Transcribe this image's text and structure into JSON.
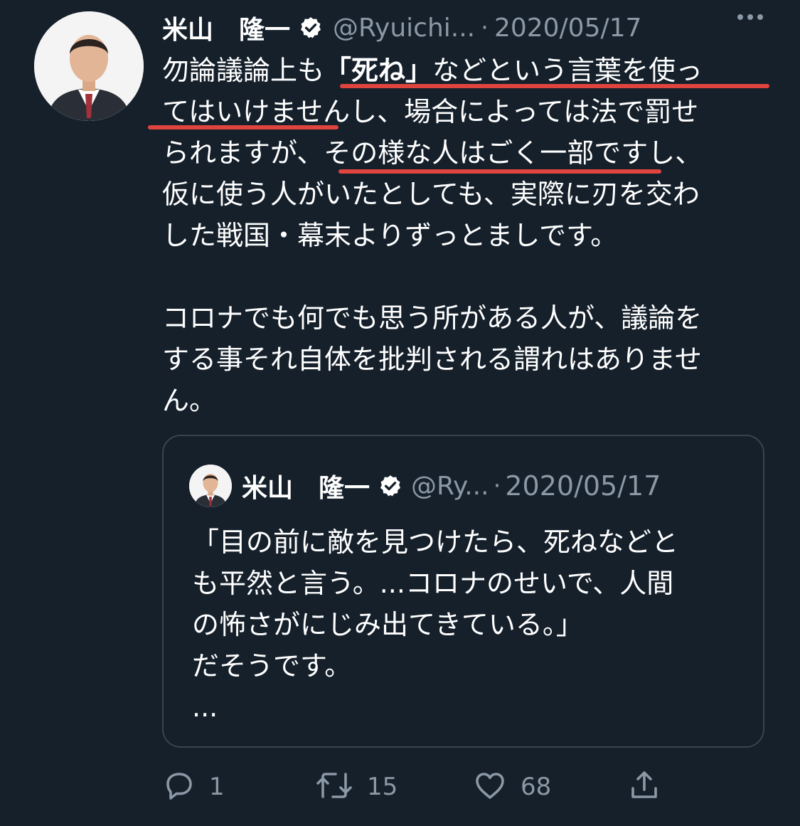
{
  "tweet": {
    "author_name": "米山　隆一",
    "handle": "@Ryuichi...",
    "separator": "·",
    "date": "2020/05/17",
    "body": {
      "line1_pre": "勿論議論上も",
      "line1_bold": "「死ね」",
      "line1_post": "などという言葉を使っ",
      "line2": "てはいけませんし、場合によっては法で罰せ",
      "line3": "られますが、その様な人はごく一部ですし、",
      "line4": "仮に使う人がいたとしても、実際に刃を交わ",
      "line5": "した戦国・幕末よりずっとましです。",
      "line6": "コロナでも何でも思う所がある人が、議論を",
      "line7": "する事それ自体を批判される謂れはありませ",
      "line8": "ん。"
    },
    "highlight_color": "#e0443e"
  },
  "quoted_tweet": {
    "author_name": "米山　隆一",
    "handle": "@Ry...",
    "separator": "·",
    "date": "2020/05/17",
    "lines": [
      "「目の前に敵を見つけたら、死ねなどと",
      "も平然と言う。...コロナのせいで、人間",
      "の怖さがにじみ出てきている。」",
      "だそうです。",
      "..."
    ]
  },
  "actions": {
    "reply_count": "1",
    "retweet_count": "15",
    "like_count": "68"
  },
  "icons": {
    "verified": "verified-badge-icon",
    "more": "more-horizontal-icon",
    "reply": "reply-icon",
    "retweet": "retweet-icon",
    "like": "heart-icon",
    "share": "share-icon"
  },
  "colors": {
    "background": "#15202b",
    "secondary_text": "#8b98a5",
    "border": "#38444d"
  }
}
